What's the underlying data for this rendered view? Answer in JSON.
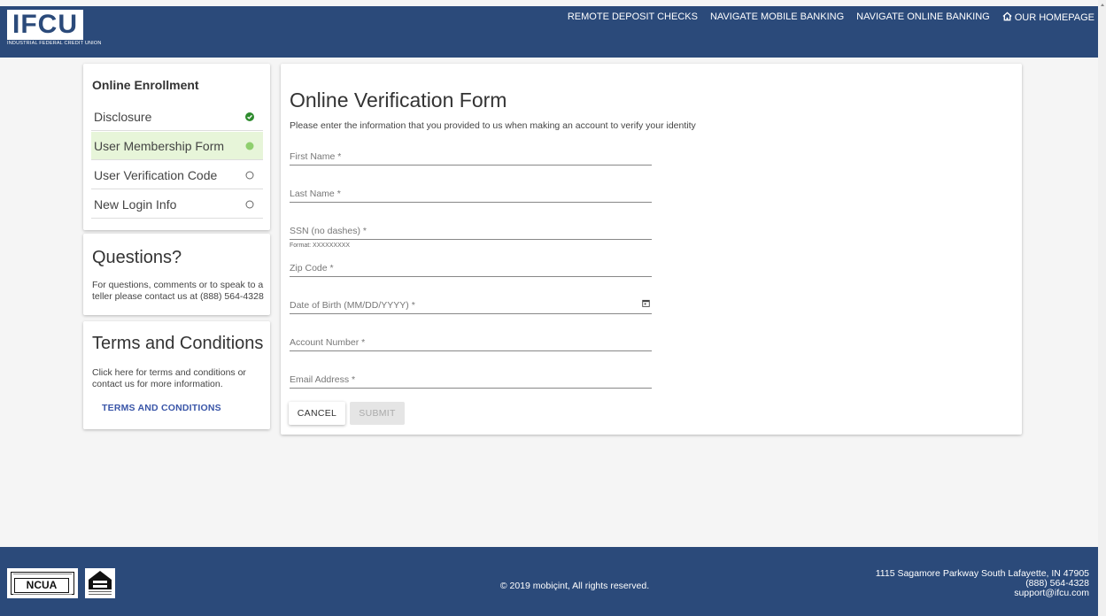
{
  "header": {
    "logo_text": "IFCU",
    "logo_sub": "INDUSTRIAL FEDERAL CREDIT UNION",
    "nav": [
      {
        "label": "REMOTE DEPOSIT CHECKS"
      },
      {
        "label": "NAVIGATE MOBILE BANKING"
      },
      {
        "label": "NAVIGATE ONLINE BANKING"
      },
      {
        "label": "OUR HOMEPAGE",
        "icon": "home-icon"
      }
    ]
  },
  "steps": {
    "title": "Online Enrollment",
    "items": [
      {
        "label": "Disclosure",
        "status": "complete",
        "icon": "check-circle-icon"
      },
      {
        "label": "User Membership Form",
        "status": "current",
        "icon": "filled-circle-icon"
      },
      {
        "label": "User Verification Code",
        "status": "pending",
        "icon": "empty-circle-icon"
      },
      {
        "label": "New Login Info",
        "status": "pending",
        "icon": "empty-circle-icon"
      }
    ]
  },
  "questions": {
    "title": "Questions?",
    "text": "For questions, comments or to speak to a teller please contact us at (888) 564-4328"
  },
  "terms": {
    "title": "Terms and Conditions",
    "text": "Click here for terms and conditions or contact us for more information.",
    "link_label": "TERMS AND CONDITIONS"
  },
  "form": {
    "title": "Online Verification Form",
    "description": "Please enter the information that you provided to us when making an account to verify your identity",
    "fields": [
      {
        "placeholder": "First Name *",
        "value": ""
      },
      {
        "placeholder": "Last Name *",
        "value": ""
      },
      {
        "placeholder": "SSN (no dashes) *",
        "value": "",
        "hint": "Format: XXXXXXXXX"
      },
      {
        "placeholder": "Zip Code *",
        "value": ""
      },
      {
        "placeholder": "Date of Birth (MM/DD/YYYY) *",
        "value": "",
        "icon": "calendar-icon"
      },
      {
        "placeholder": "Account Number *",
        "value": ""
      },
      {
        "placeholder": "Email Address *",
        "value": ""
      }
    ],
    "cancel_label": "CANCEL",
    "submit_label": "SUBMIT"
  },
  "footer": {
    "ncua_label": "NCUA",
    "ehl_label": "EQUAL HOUSING OPPORTUNITY",
    "copyright": "© 2019 mobiçint, All rights reserved.",
    "address_line1": "1115 Sagamore Parkway South Lafayette, IN 47905",
    "phone": "(888) 564-4328",
    "email": "support@ifcu.com"
  },
  "colors": {
    "brand_blue": "#2b4a7a",
    "step_complete": "#2e8b2e",
    "step_current": "#8fcf6e",
    "active_step_bg": "#e7f5d9",
    "link": "#3a56a8"
  }
}
